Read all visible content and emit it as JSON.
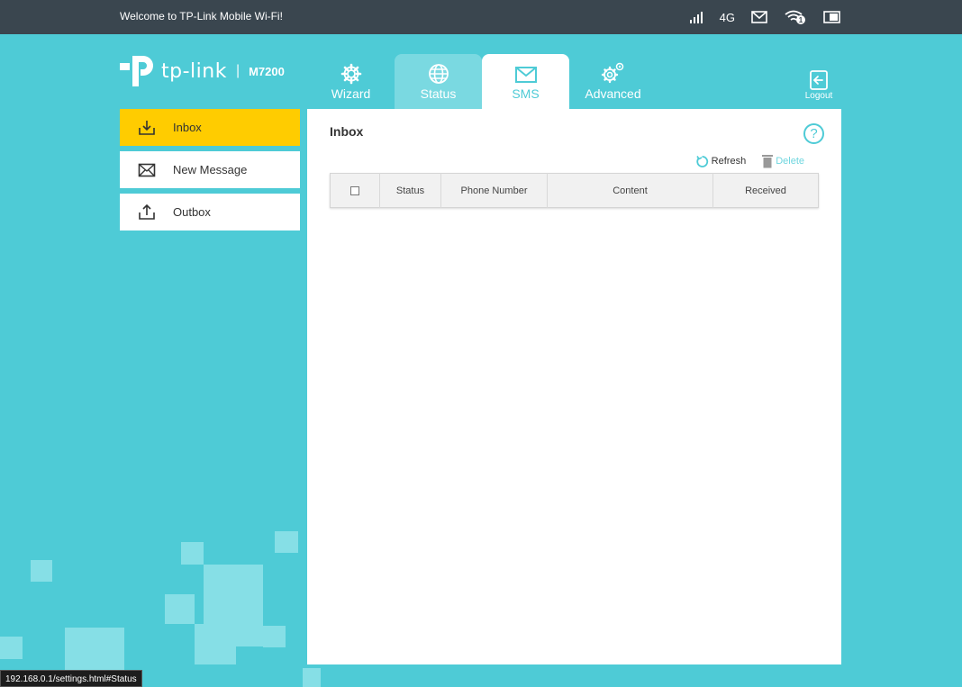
{
  "topbar": {
    "welcome": "Welcome to TP-Link Mobile Wi-Fi!",
    "network_type": "4G",
    "wifi_badge": "1",
    "icons": [
      "signal-icon",
      "envelope-icon",
      "wifi-icon",
      "battery-icon"
    ]
  },
  "header": {
    "brand": "tp-link",
    "separator": "|",
    "model": "M7200",
    "logout_label": "Logout"
  },
  "tabs": [
    {
      "label": "Wizard",
      "icon": "gear-icon",
      "state": "normal"
    },
    {
      "label": "Status",
      "icon": "globe-icon",
      "state": "hover"
    },
    {
      "label": "SMS",
      "icon": "envelope-icon",
      "state": "active"
    },
    {
      "label": "Advanced",
      "icon": "gears-icon",
      "state": "normal"
    }
  ],
  "sidebar": {
    "items": [
      {
        "label": "Inbox",
        "icon": "inbox-download-icon",
        "active": true
      },
      {
        "label": "New Message",
        "icon": "envelope-icon",
        "active": false
      },
      {
        "label": "Outbox",
        "icon": "outbox-upload-icon",
        "active": false
      }
    ]
  },
  "main": {
    "title": "Inbox",
    "help_label": "?",
    "refresh_label": "Refresh",
    "delete_label": "Delete",
    "columns": [
      "",
      "Status",
      "Phone Number",
      "Content",
      "Received"
    ]
  },
  "statusbar": {
    "url": "192.168.0.1/settings.html#Status"
  },
  "colors": {
    "accent": "#4ecbd6",
    "topbar": "#3a464f",
    "active_sidebar": "#ffcc00"
  }
}
